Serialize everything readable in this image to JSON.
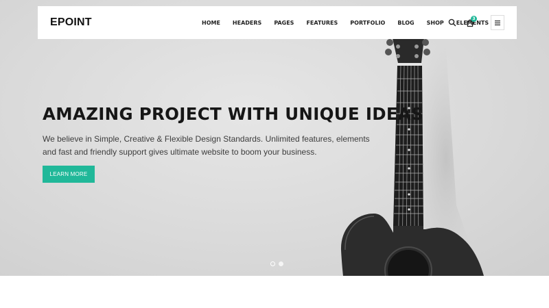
{
  "brand": {
    "logo_text": "EPOINT"
  },
  "nav": {
    "items": [
      {
        "label": "HOME"
      },
      {
        "label": "HEADERS"
      },
      {
        "label": "PAGES"
      },
      {
        "label": "FEATURES"
      },
      {
        "label": "PORTFOLIO"
      },
      {
        "label": "BLOG"
      },
      {
        "label": "SHOP"
      },
      {
        "label": "ELEMENTS"
      }
    ],
    "search_icon": "search-icon",
    "cart_icon": "shopping-bag-icon",
    "cart_count": "3",
    "menu_icon": "hamburger-icon"
  },
  "hero": {
    "title": "AMAZING PROJECT WITH UNIQUE IDEAS",
    "description": "We believe in Simple, Creative & Flexible Design Standards. Unlimited features, elements and fast and friendly support gives ultimate website to boom your business.",
    "button_label": "LEARN MORE",
    "slides": [
      {
        "active": true
      },
      {
        "active": false
      }
    ]
  },
  "colors": {
    "accent": "#20b899",
    "hero_background": "#dadada",
    "text_dark": "#161616"
  }
}
